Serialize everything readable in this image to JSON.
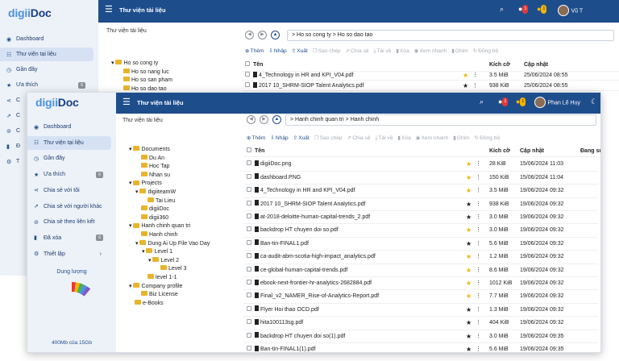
{
  "app": {
    "logo_a": "digii",
    "logo_b": "Doc"
  },
  "back": {
    "title": "Thư viện tài liệu",
    "panel_title": "Thư viện tài liệu",
    "user_name": "Vũ T",
    "notif_count": "1",
    "alert_count": "1",
    "breadcrumb": "> Ho so cong ty  > Ho so dao tao",
    "nav": [
      {
        "label": "Dashboard",
        "icon": "dashboard-icon"
      },
      {
        "label": "Thư viện tại liệu",
        "icon": "library-icon",
        "active": true
      },
      {
        "label": "Gần đây",
        "icon": "clock-icon"
      },
      {
        "label": "Ưa thích",
        "icon": "star-icon",
        "count": "6"
      },
      {
        "label": "C",
        "icon": "share-icon"
      },
      {
        "label": "C",
        "icon": "share-other-icon"
      },
      {
        "label": "C",
        "icon": "link-icon"
      },
      {
        "label": "Đ",
        "icon": "trash-icon"
      },
      {
        "label": "T",
        "icon": "settings-icon"
      }
    ],
    "tree": [
      "Ho so cong ty",
      "Ho so nang luc",
      "Ho so san pham",
      "Ho so dao tao"
    ],
    "toolbar": [
      "Thêm",
      "Nhập",
      "Xuất",
      "Sao chép",
      "Chia sẻ",
      "Tải về",
      "Xóa",
      "Xem nhanh",
      "Ghim",
      "Đồng bộ"
    ],
    "headers": {
      "name": "Tên",
      "size": "Kích cỡ",
      "updated": "Cập nhật"
    },
    "files": [
      {
        "name": "4_Technology in HR and KPI_V04.pdf",
        "size": "3.5 MiB",
        "date": "25/06/2024 08:55",
        "starred": true
      },
      {
        "name": "2017 10_SHRM-SIOP Talent Analytics.pdf",
        "size": "938 KiB",
        "date": "25/06/2024 08:55",
        "starred": false
      }
    ]
  },
  "front": {
    "title": "Thư viện tài liệu",
    "panel_title": "Thư viện tài liệu",
    "user_name": "Phan Lê Huy",
    "notif_count": "1",
    "alert_count": "1",
    "breadcrumb": "> Hanh chinh quan tri  > Hanh chinh",
    "nav": [
      {
        "label": "Dashboard",
        "icon": "dashboard-icon"
      },
      {
        "label": "Thư viện tại liệu",
        "icon": "library-icon",
        "active": true
      },
      {
        "label": "Gần đây",
        "icon": "clock-icon"
      },
      {
        "label": "Ưa thích",
        "icon": "star-icon",
        "count": "6"
      },
      {
        "label": "Chia sẻ với tôi",
        "icon": "share-icon"
      },
      {
        "label": "Chia sẻ với người khác",
        "icon": "share-other-icon"
      },
      {
        "label": "Chia sẻ theo liên kết",
        "icon": "link-icon"
      },
      {
        "label": "Đã xóa",
        "icon": "trash-icon",
        "count": "6"
      },
      {
        "label": "Thiết lập",
        "icon": "settings-icon",
        "arrow": "›"
      }
    ],
    "storage": {
      "title": "Dung lượng",
      "caption": "400Mb của 15Gb",
      "used_fraction": 0.027
    },
    "tree": [
      {
        "label": "Documents",
        "depth": 0,
        "toggle": "▾"
      },
      {
        "label": "Du An",
        "depth": 1
      },
      {
        "label": "Hoc Tap",
        "depth": 1
      },
      {
        "label": "Nhan su",
        "depth": 1
      },
      {
        "label": "Projects",
        "depth": 0,
        "toggle": "▾"
      },
      {
        "label": "digiiteamW",
        "depth": 1,
        "toggle": "▾"
      },
      {
        "label": "Tai Lieu",
        "depth": 2
      },
      {
        "label": "digiiDoc",
        "depth": 1
      },
      {
        "label": "digii360",
        "depth": 1
      },
      {
        "label": "Hanh chinh quan tri",
        "depth": 0,
        "toggle": "▾"
      },
      {
        "label": "Hanh chinh",
        "depth": 1
      },
      {
        "label": "Dung Ai Up File Vao Day",
        "depth": 1,
        "toggle": "▾"
      },
      {
        "label": "Level 1",
        "depth": 2,
        "toggle": "▾"
      },
      {
        "label": "Level 2",
        "depth": 3,
        "toggle": "▾"
      },
      {
        "label": "Level 3",
        "depth": 4
      },
      {
        "label": "level 1-1",
        "depth": 2
      },
      {
        "label": "Company profile",
        "depth": 0,
        "toggle": "▾"
      },
      {
        "label": "Biz License",
        "depth": 1
      },
      {
        "label": "e-Books",
        "depth": 0
      }
    ],
    "toolbar": [
      "Thêm",
      "Nhập",
      "Xuất",
      "Sao chép",
      "Chia sẻ",
      "Tải về",
      "Xóa",
      "Xem nhanh",
      "Ghim",
      "Đồng bộ"
    ],
    "headers": {
      "name": "Tên",
      "size": "Kích cỡ",
      "updated": "Cập nhật",
      "user": "Đang sử dụng"
    },
    "files": [
      {
        "name": "digiiDoc.png",
        "size": "28 KiB",
        "date": "15/06/2024 11:03",
        "starred": true
      },
      {
        "name": "dashboard.PNG",
        "size": "150 KiB",
        "date": "15/06/2024 11:04",
        "starred": true
      },
      {
        "name": "4_Technology in HR and KPI_V04.pdf",
        "size": "3.5 MiB",
        "date": "19/06/2024 09:32",
        "starred": true
      },
      {
        "name": "2017 10_SHRM-SIOP Talent Analytics.pdf",
        "size": "938 KiB",
        "date": "19/06/2024 09:32",
        "starred": false
      },
      {
        "name": "at-2018-deloitte-human-capital-trends_2.pdf",
        "size": "3.0 MiB",
        "date": "19/06/2024 09:32",
        "starred": false
      },
      {
        "name": "backdrop HT chuyen doi so.pdf",
        "size": "3.0 MiB",
        "date": "19/06/2024 09:32",
        "starred": true
      },
      {
        "name": "Ban-tin-FINAL1.pdf",
        "size": "5.6 MiB",
        "date": "19/06/2024 09:32",
        "starred": false
      },
      {
        "name": "ca-audit-abm-scotia-high-impact_analytics.pdf",
        "size": "1.2 MiB",
        "date": "19/06/2024 09:32",
        "starred": true
      },
      {
        "name": "ce-global-human-capital-trends.pdf",
        "size": "8.6 MiB",
        "date": "19/06/2024 09:32",
        "starred": true
      },
      {
        "name": "ebook-next-frontier-hr-analytics-2682884.pdf",
        "size": "1012 KiB",
        "date": "19/06/2024 09:32",
        "starred": true
      },
      {
        "name": "Final_v2_NAMER_Rise-of-Analytics-Report.pdf",
        "size": "7.7 MiB",
        "date": "19/06/2024 09:32",
        "starred": true
      },
      {
        "name": "Flyer Hoi thao OCD.pdf",
        "size": "1.3 MiB",
        "date": "19/06/2024 09:32",
        "starred": false
      },
      {
        "name": "hita100113sg.pdf",
        "size": "404 KiB",
        "date": "19/06/2024 09:32",
        "starred": false
      },
      {
        "name": "backdrop HT chuyen doi so(1).pdf",
        "size": "3.0 MiB",
        "date": "19/06/2024 09:35",
        "starred": false
      },
      {
        "name": "Ban-tin-FINAL1(1).pdf",
        "size": "5.6 MiB",
        "date": "19/06/2024 09:35",
        "starred": false
      }
    ]
  },
  "colors": {
    "primary": "#1e4d8c",
    "star": "#f4b400",
    "folder": "#e8b42c",
    "sidebar": "#edf2f9",
    "donut": [
      "#e53935",
      "#f4b400",
      "#4caf50",
      "#4a90e2",
      "#7e57c2",
      "#eef1f6"
    ]
  }
}
